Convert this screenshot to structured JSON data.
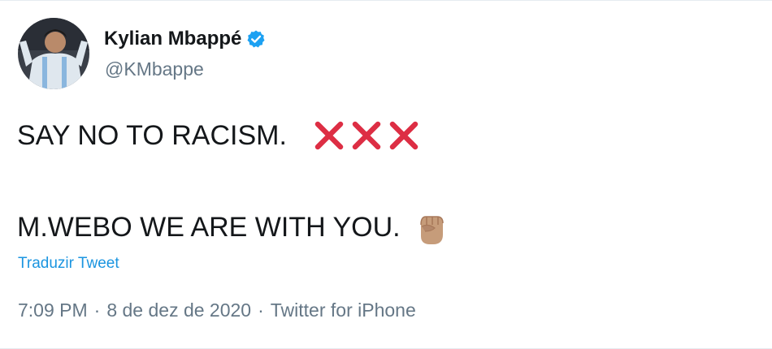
{
  "tweet": {
    "author": {
      "display_name": "Kylian Mbappé",
      "handle": "@KMbappe",
      "verified": true,
      "verified_color": "#1da1f2"
    },
    "body": {
      "line1": "SAY NO TO RACISM.",
      "line1_emoji": [
        "cross-mark-icon",
        "cross-mark-icon",
        "cross-mark-icon"
      ],
      "line2": "M.WEBO WE ARE WITH YOU.",
      "line2_emoji": "raised-fist-icon"
    },
    "translate_label": "Traduzir Tweet",
    "meta": {
      "time": "7:09 PM",
      "date": "8 de dez de 2020",
      "separator": "·",
      "source": "Twitter for iPhone"
    },
    "colors": {
      "text": "#14171a",
      "secondary": "#657786",
      "link": "#1b95e0",
      "cross": "#dd2e44",
      "fist": "#c69c7a"
    }
  }
}
